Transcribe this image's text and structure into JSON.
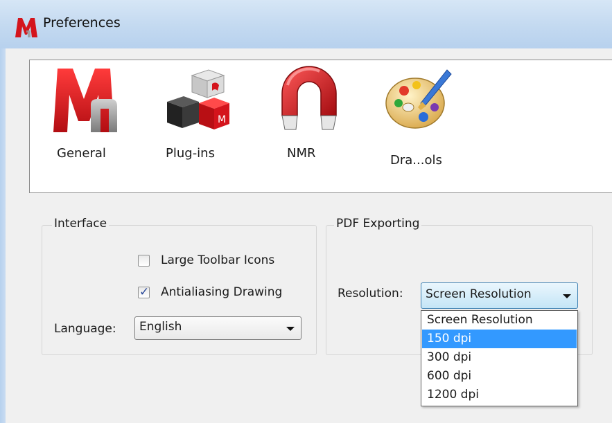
{
  "window": {
    "title": "Preferences"
  },
  "categories": [
    {
      "label": "General",
      "icon": "general-m-logo-icon"
    },
    {
      "label": "Plug-ins",
      "icon": "plugin-blocks-icon"
    },
    {
      "label": "NMR",
      "icon": "magnet-icon"
    },
    {
      "label": "Dra...ols",
      "icon": "paint-palette-icon"
    }
  ],
  "interface": {
    "title": "Interface",
    "large_toolbar_icons": {
      "label": "Large Toolbar Icons",
      "checked": false
    },
    "antialiasing_drawing": {
      "label": "Antialiasing Drawing",
      "checked": true
    },
    "language": {
      "label": "Language:",
      "value": "English"
    }
  },
  "pdf_exporting": {
    "title": "PDF Exporting",
    "resolution": {
      "label": "Resolution:",
      "value": "Screen Resolution",
      "options": [
        "Screen Resolution",
        "150 dpi",
        "300 dpi",
        "600 dpi",
        "1200 dpi"
      ],
      "highlighted": "150 dpi"
    }
  },
  "colors": {
    "accent_highlight": "#3399ff",
    "titlebar": "#c3d9f0",
    "logo_red": "#d4141c"
  }
}
